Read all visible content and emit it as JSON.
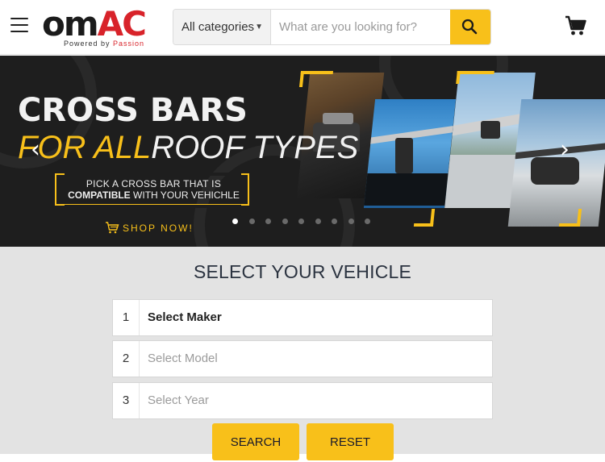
{
  "header": {
    "logo": {
      "word_dark": "om",
      "word_red": "AC",
      "tagline_prefix": "Powered by ",
      "tagline_accent": "Passion"
    },
    "category_select": {
      "value": "All categories"
    },
    "search": {
      "placeholder": "What are you looking for?"
    }
  },
  "hero": {
    "title_line1": "CROSS BARS",
    "title_line2_highlight": "FOR ALL",
    "title_line2_rest": "ROOF TYPES",
    "box_line1": "PICK A CROSS BAR THAT IS",
    "box_line2_bold": "COMPATIBLE",
    "box_line2_rest": " WITH YOUR VEHICHLE",
    "cta": "SHOP NOW!",
    "slide_count": 9,
    "active_slide": 0
  },
  "selector": {
    "title": "SELECT YOUR VEHICLE",
    "steps": [
      {
        "num": "1",
        "label": "Select Maker",
        "state": "active"
      },
      {
        "num": "2",
        "label": "Select Model",
        "state": "disabled"
      },
      {
        "num": "3",
        "label": "Select Year",
        "state": "disabled"
      }
    ],
    "search_button": "SEARCH",
    "reset_button": "RESET"
  },
  "colors": {
    "accent": "#f8c01a",
    "brand_red": "#d8232a",
    "hero_bg": "#1e1e1e",
    "selector_bg": "#e3e3e3"
  },
  "icons": {
    "menu": "hamburger-icon",
    "search": "magnifier-icon",
    "cart": "cart-icon",
    "prev": "chevron-left-icon",
    "next": "chevron-right-icon",
    "cta": "shopping-cart-icon"
  }
}
